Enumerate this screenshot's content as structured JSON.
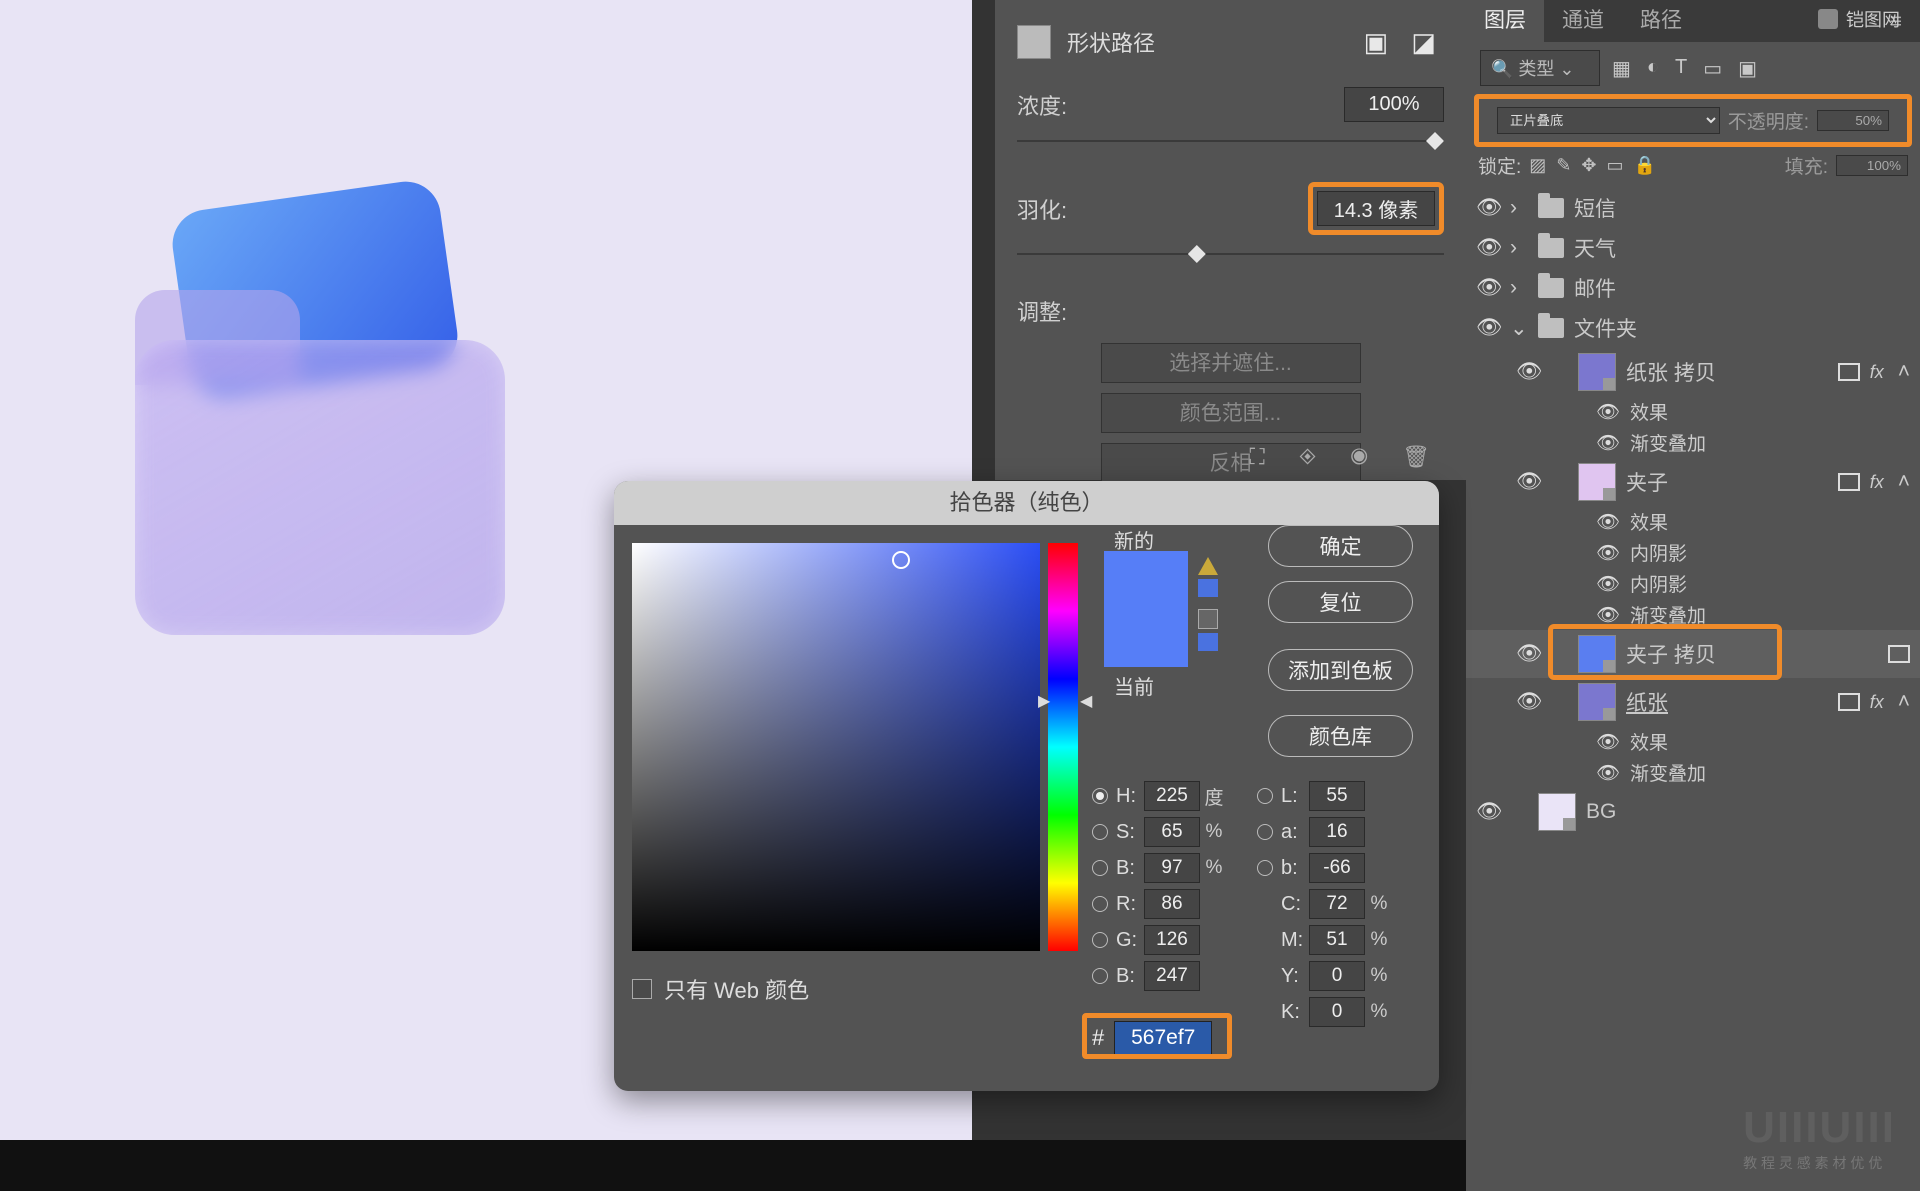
{
  "canvas": {
    "bg": "#e8e4f5"
  },
  "properties": {
    "header": "形状路径",
    "density_label": "浓度:",
    "density_value": "100%",
    "feather_label": "羽化:",
    "feather_value": "14.3 像素",
    "adjust_label": "调整:",
    "btn_select_mask": "选择并遮住...",
    "btn_color_range": "颜色范围...",
    "btn_invert": "反相"
  },
  "layers_panel": {
    "tabs": [
      "图层",
      "通道",
      "路径"
    ],
    "filter_placeholder": "类型",
    "blend_mode": "正片叠底",
    "opacity_label": "不透明度:",
    "opacity_value": "50%",
    "lock_label": "锁定:",
    "fill_label": "填充:",
    "fill_value": "100%",
    "layers": [
      {
        "type": "group",
        "name": "短信",
        "expanded": false
      },
      {
        "type": "group",
        "name": "天气",
        "expanded": false
      },
      {
        "type": "group",
        "name": "邮件",
        "expanded": false
      },
      {
        "type": "group",
        "name": "文件夹",
        "expanded": true,
        "children": [
          {
            "type": "shape",
            "name": "纸张 拷贝",
            "fx": true,
            "effects": [
              "效果",
              "渐变叠加"
            ]
          },
          {
            "type": "shape",
            "name": "夹子",
            "fx": true,
            "effects": [
              "效果",
              "内阴影",
              "内阴影",
              "渐变叠加"
            ],
            "thumb": "pink"
          },
          {
            "type": "shape",
            "name": "夹子 拷贝",
            "selected": true,
            "thumb": "blue"
          },
          {
            "type": "shape",
            "name": "纸张",
            "fx": true,
            "underline": true,
            "effects": [
              "效果",
              "渐变叠加"
            ]
          }
        ]
      },
      {
        "type": "shape",
        "name": "BG",
        "thumb": "light"
      }
    ]
  },
  "color_picker": {
    "title": "拾色器（纯色）",
    "new_label": "新的",
    "current_label": "当前",
    "btn_ok": "确定",
    "btn_reset": "复位",
    "btn_add_swatch": "添加到色板",
    "btn_library": "颜色库",
    "web_only": "只有 Web 颜色",
    "fields": {
      "H": {
        "value": "225",
        "unit": "度"
      },
      "S": {
        "value": "65",
        "unit": "%"
      },
      "B": {
        "value": "97",
        "unit": "%"
      },
      "L": {
        "value": "55",
        "unit": ""
      },
      "a": {
        "value": "16",
        "unit": ""
      },
      "b2": {
        "value": "-66",
        "unit": ""
      },
      "R": {
        "value": "86",
        "unit": ""
      },
      "G": {
        "value": "126",
        "unit": ""
      },
      "Bc": {
        "value": "247",
        "unit": ""
      },
      "C": {
        "value": "72",
        "unit": "%"
      },
      "M": {
        "value": "51",
        "unit": "%"
      },
      "Y": {
        "value": "0",
        "unit": "%"
      },
      "K": {
        "value": "0",
        "unit": "%"
      }
    },
    "hex": "567ef7"
  },
  "watermark": {
    "brand": "UIIIUIII",
    "sub": "教 程 灵 感 素 材 优 优",
    "top": "铠图网"
  }
}
